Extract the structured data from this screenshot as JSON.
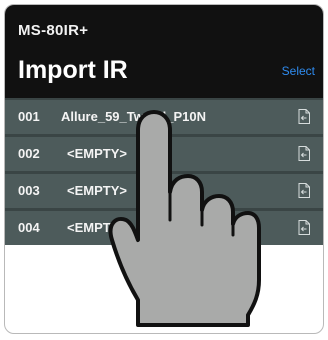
{
  "header": {
    "device_name": "MS-80IR+",
    "title": "Import IR",
    "select_label": "Select"
  },
  "colors": {
    "header_bg": "#111111",
    "row_bg": "#4d5b5b",
    "accent": "#2f8cf0",
    "hand_fill": "#a9aaa9"
  },
  "ir_list": [
    {
      "number": "001",
      "name": "Allure_59_Tweed_P10N",
      "icon": "import-file-icon"
    },
    {
      "number": "002",
      "name": "<EMPTY>",
      "icon": "import-file-icon"
    },
    {
      "number": "003",
      "name": "<EMPTY>",
      "icon": "import-file-icon"
    },
    {
      "number": "004",
      "name": "<EMPTY>",
      "icon": "import-file-icon"
    }
  ],
  "overlay": {
    "icon": "pointing-hand-icon"
  }
}
